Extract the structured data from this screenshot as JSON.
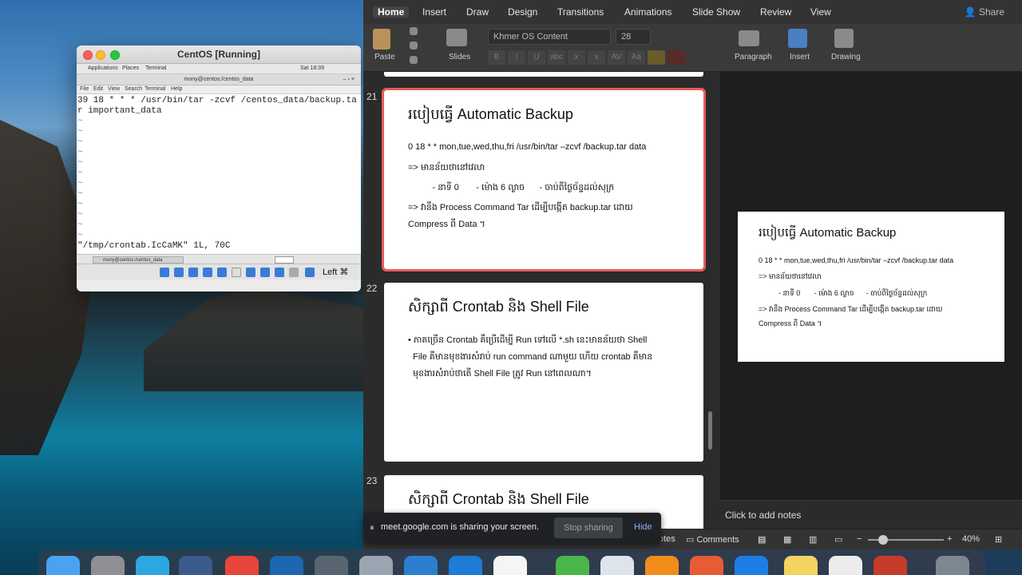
{
  "vbox": {
    "title": "CentOS [Running]",
    "gnome": {
      "applications": "Applications",
      "places": "Places",
      "terminal": "Terminal",
      "time": "Sat 18:39"
    },
    "terminal_title": "mony@centos:/centos_data",
    "menu": [
      "File",
      "Edit",
      "View",
      "Search",
      "Terminal",
      "Help"
    ],
    "lines": [
      "39 18 * * * /usr/bin/tar -zcvf /centos_data/backup.tar important_data"
    ],
    "tilde_count": 12,
    "status_line": "\"/tmp/crontab.IcCaMK\" 1L, 70C",
    "taskbar_item": "mony@centos:/centos_data",
    "host_key": "Left ⌘"
  },
  "ppt": {
    "tabs": [
      "Home",
      "Insert",
      "Draw",
      "Design",
      "Transitions",
      "Animations",
      "Slide Show",
      "Review",
      "View"
    ],
    "share": "Share",
    "ribbon": {
      "paste": "Paste",
      "slides": "Slides",
      "font": "Khmer OS Content",
      "size": "28",
      "paragraph": "Paragraph",
      "insert": "Insert",
      "drawing": "Drawing"
    },
    "slides": [
      {
        "num": "21",
        "title": "របៀបធ្វើ Automatic Backup",
        "lines": [
          "0 18 * * mon,tue,wed,thu,fri /usr/bin/tar –zcvf /backup.tar   data",
          "=> មានន័យថានៅវេលា",
          "          - នាទី 0       - ម៉ោង 6 ល្ងាច      - ចាប់ពីថ្ងៃច័ន្ទដល់សុក្រ",
          "=> វានឹង Process Command Tar ដើម្បីបង្កើត backup.tar ដោយ",
          "Compress ពី Data ។"
        ]
      },
      {
        "num": "22",
        "title": "សិក្សាពី Crontab និង Shell File",
        "lines": [
          "• ភាគច្រើន Crontab គឺប្រើដើម្បី Run ទៅលើ *.sh នេះមានន័យថា Shell",
          "  File គឺមានមុខងារសំរាប់ run command ណាមួយ ហើយ crontab គឺមាន",
          "  មុខងារសំរាប់ថាតើ Shell File ត្រូវ Run នៅពេលណា។"
        ]
      },
      {
        "num": "23",
        "title": "សិក្សាពី Crontab និង Shell File"
      }
    ],
    "notes_placeholder": "Click to add notes",
    "status": {
      "notes": "otes",
      "comments": "Comments",
      "zoom": "40%"
    }
  },
  "meet": {
    "pause": "⏸",
    "text": "meet.google.com is sharing your screen.",
    "stop": "Stop sharing",
    "hide": "Hide"
  },
  "colors": {
    "selected_outline": "#e85a5a",
    "meet_link": "#8ab4f8"
  }
}
